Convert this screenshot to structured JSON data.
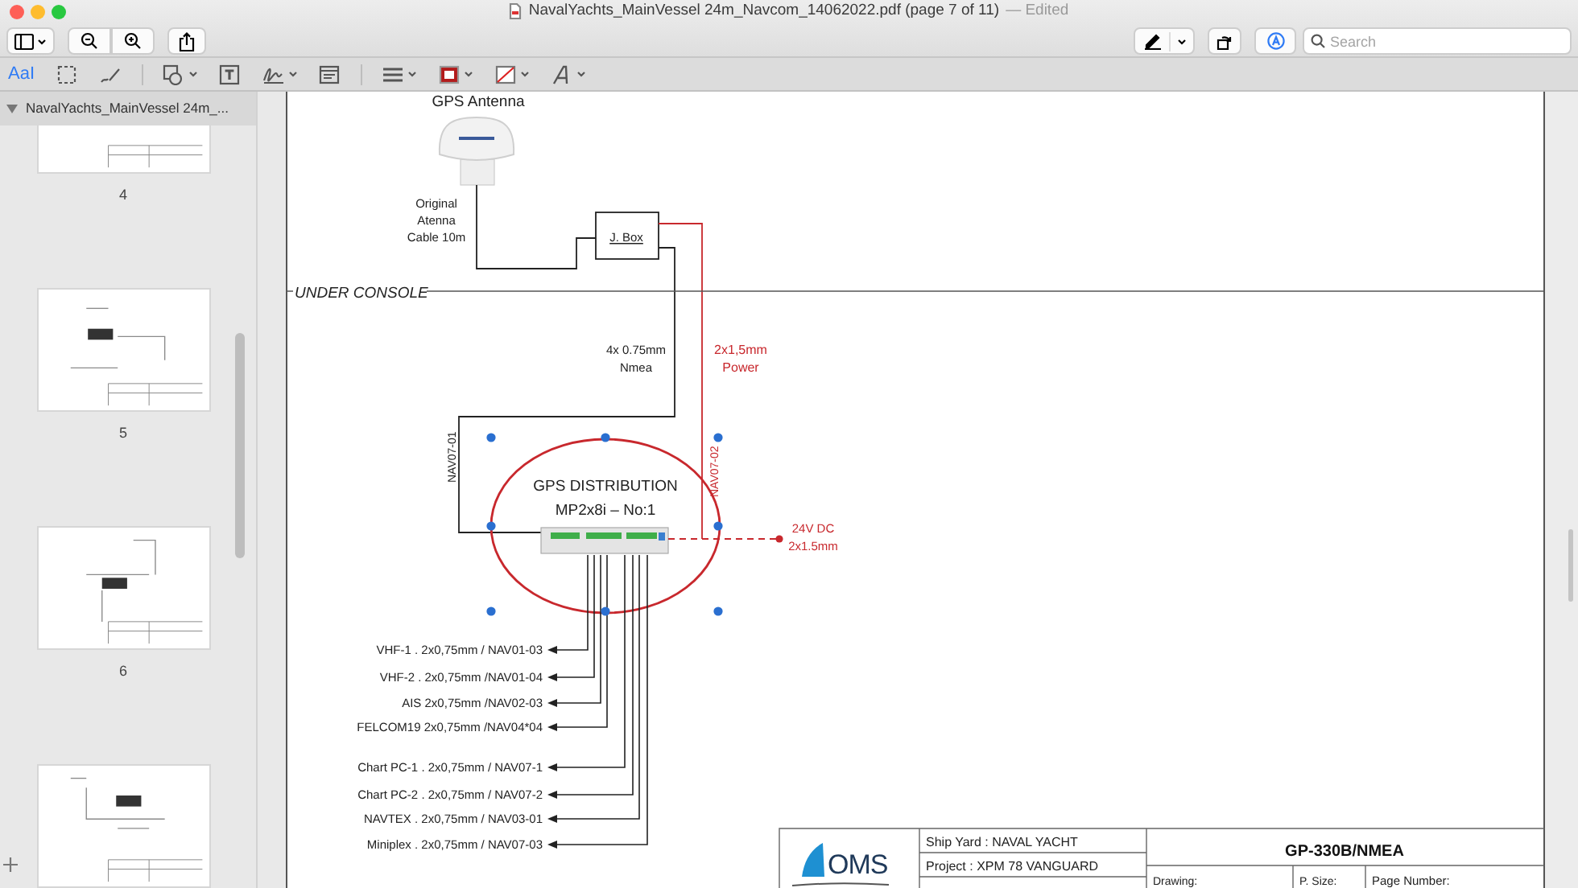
{
  "window": {
    "title": "NavalYachts_MainVessel 24m_Navcom_14062022.pdf (page 7 of 11)",
    "status": "— Edited"
  },
  "toolbar": {
    "search": {
      "placeholder": "Search"
    }
  },
  "markup_toolbar": {
    "groups": [
      [
        {
          "kind": "text-select",
          "label": "AaI",
          "selected": true,
          "has_menu": false
        },
        {
          "kind": "rect-select",
          "selected": false,
          "has_menu": false
        },
        {
          "kind": "sketch",
          "selected": false,
          "has_menu": false
        }
      ],
      [
        {
          "kind": "shapes",
          "selected": false,
          "has_menu": true
        },
        {
          "kind": "text-box",
          "selected": false,
          "has_menu": false
        },
        {
          "kind": "sign",
          "selected": false,
          "has_menu": true
        },
        {
          "kind": "note",
          "selected": false,
          "has_menu": false
        }
      ],
      [
        {
          "kind": "line-style",
          "selected": false,
          "has_menu": true
        },
        {
          "kind": "border-color",
          "selected": false,
          "has_menu": true
        },
        {
          "kind": "fill-color",
          "selected": false,
          "has_menu": true
        },
        {
          "kind": "font",
          "selected": false,
          "has_menu": true
        }
      ]
    ]
  },
  "sidebar": {
    "document_title": "NavalYachts_MainVessel 24m_...",
    "expanded": true,
    "pages": [
      {
        "kind": "full",
        "label": "4"
      },
      {
        "kind": "full",
        "label": "5"
      },
      {
        "kind": "full",
        "label": "6"
      },
      {
        "kind": "cut"
      }
    ]
  },
  "drawing": {
    "antenna_label": "GPS Antenna",
    "antenna_cable_label": [
      "Original",
      "Atenna",
      "Cable 10m"
    ],
    "junction_box": "J. Box",
    "zone_label": "UNDER CONSOLE",
    "nmea_cable_label": [
      "4x 0.75mm",
      "Nmea"
    ],
    "power_cable_label": [
      "2x1,5mm",
      "Power"
    ],
    "cable_tags": [
      {
        "text": "NAV07-01",
        "color": "#222222"
      },
      {
        "text": "NAV07-02",
        "color": "#c8282d"
      }
    ],
    "distribution": {
      "title": "GPS DISTRIBUTION",
      "model": "MP2x8i – No:1",
      "selected": true
    },
    "power_supply_label": [
      "24V DC",
      "2x1.5mm"
    ],
    "outputs": [
      {
        "text": "VHF-1 . 2x0,75mm / NAV01-03"
      },
      {
        "text": "VHF-2 . 2x0,75mm /NAV01-04"
      },
      {
        "text": "AIS 2x0,75mm /NAV02-03"
      },
      {
        "text": "FELCOM19 2x0,75mm /NAV04*04"
      },
      {
        "text": "Chart PC-1 . 2x0,75mm / NAV07-1"
      },
      {
        "text": "Chart PC-2 . 2x0,75mm / NAV07-2"
      },
      {
        "text": "NAVTEX . 2x0,75mm / NAV03-01"
      },
      {
        "text": "Miniplex . 2x0,75mm / NAV07-03"
      }
    ]
  },
  "title_block": {
    "logo": "OMS",
    "ship_yard": "Ship Yard : NAVAL YACHT",
    "project": "Project : XPM 78 VANGUARD",
    "drawing_title": "GP-330B/NMEA",
    "drawing_label": "Drawing:",
    "paper_size_label": "P. Size:",
    "page_number_label": "Page Number:"
  }
}
